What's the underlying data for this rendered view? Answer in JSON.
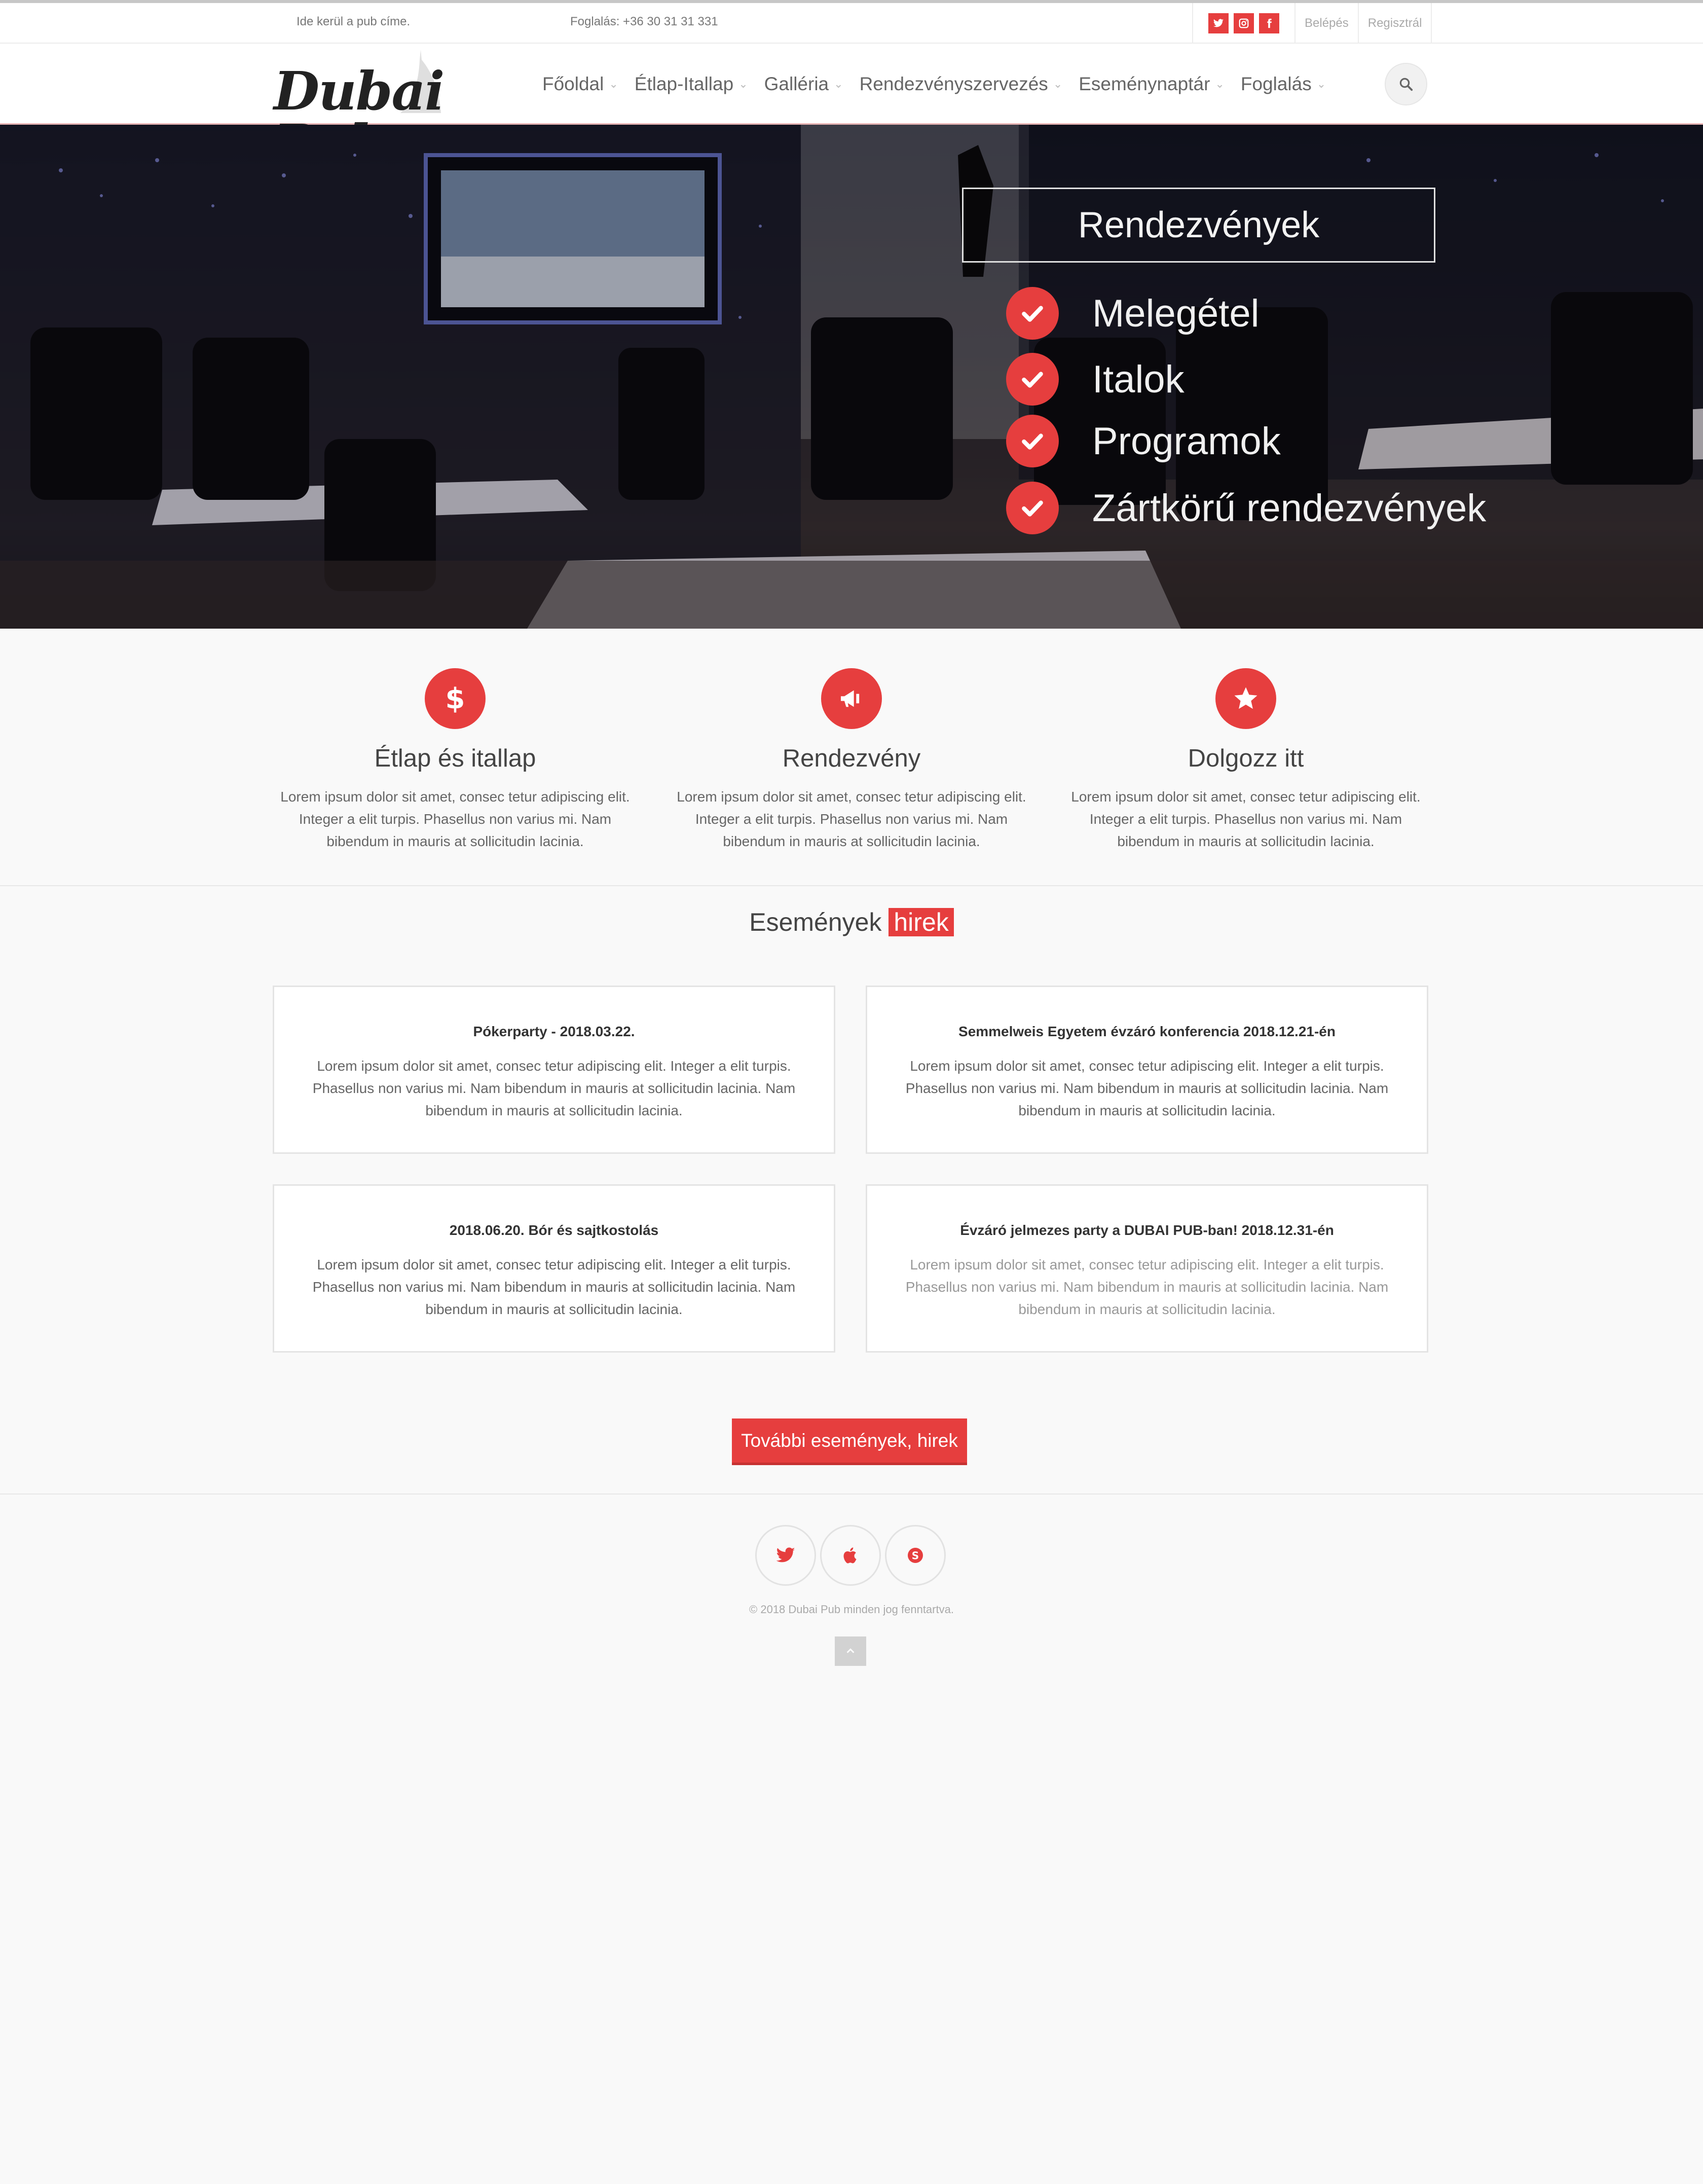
{
  "topbar": {
    "address": "Ide kerül a pub címe.",
    "phone": "Foglalás: +36 30 31 31 331",
    "social_icons": [
      "twitter-icon",
      "instagram-icon",
      "facebook-icon"
    ],
    "login": "Belépés",
    "register": "Regisztrál"
  },
  "header": {
    "logo_text": "Dubai Pub",
    "nav": [
      {
        "label": "Főoldal",
        "has_dropdown": true
      },
      {
        "label": "Étlap-Itallap",
        "has_dropdown": true
      },
      {
        "label": "Galléria",
        "has_dropdown": true
      },
      {
        "label": "Rendezvényszervezés",
        "has_dropdown": true
      },
      {
        "label": "Eseménynaptár",
        "has_dropdown": true
      },
      {
        "label": "Foglalás",
        "has_dropdown": true
      }
    ],
    "search_icon": "search-icon"
  },
  "hero": {
    "title": "Rendezvények",
    "items": [
      "Melegétel",
      "Italok",
      "Programok",
      "Zártkörű rendezvények"
    ]
  },
  "features": [
    {
      "icon": "dollar-icon",
      "title": "Étlap és itallap",
      "text": "Lorem ipsum dolor sit amet, consec tetur adipiscing elit. Integer a elit turpis. Phasellus non varius mi. Nam bibendum in mauris at sollicitudin lacinia."
    },
    {
      "icon": "megaphone-icon",
      "title": "Rendezvény",
      "text": "Lorem ipsum dolor sit amet, consec tetur adipiscing elit. Integer a elit turpis. Phasellus non varius mi. Nam bibendum in mauris at sollicitudin lacinia."
    },
    {
      "icon": "star-icon",
      "title": "Dolgozz itt",
      "text": "Lorem ipsum dolor sit amet, consec tetur adipiscing elit. Integer a elit turpis. Phasellus non varius mi. Nam bibendum in mauris at sollicitudin lacinia."
    }
  ],
  "news": {
    "heading": "Események",
    "heading_highlight": "hirek",
    "cards": [
      {
        "title": "Pókerparty - 2018.03.22.",
        "text": "Lorem ipsum dolor sit amet, consec tetur adipiscing elit. Integer a elit turpis. Phasellus non varius mi. Nam bibendum in mauris at sollicitudin lacinia. Nam bibendum in mauris at sollicitudin lacinia."
      },
      {
        "title": "Semmelweis Egyetem évzáró konferencia 2018.12.21-én",
        "text": "Lorem ipsum dolor sit amet, consec tetur adipiscing elit. Integer a elit turpis. Phasellus non varius mi. Nam bibendum in mauris at sollicitudin lacinia. Nam bibendum in mauris at sollicitudin lacinia."
      },
      {
        "title": "2018.06.20. Bór és sajtkostolás",
        "text": "Lorem ipsum dolor sit amet, consec tetur adipiscing elit. Integer a elit turpis. Phasellus non varius mi. Nam bibendum in mauris at sollicitudin lacinia. Nam bibendum in mauris at sollicitudin lacinia."
      },
      {
        "title": "Évzáró jelmezes party a DUBAI PUB-ban! 2018.12.31-én",
        "text": "Lorem ipsum dolor sit amet, consec tetur adipiscing elit. Integer a elit turpis. Phasellus non varius mi. Nam bibendum in mauris at sollicitudin lacinia. Nam bibendum in mauris at sollicitudin lacinia."
      }
    ],
    "more_button": "További események, hirek"
  },
  "footer": {
    "social_icons": [
      "twitter-icon",
      "apple-icon",
      "skype-icon"
    ],
    "copyright": "© 2018 Dubai Pub minden jog fenntartva."
  },
  "colors": {
    "accent": "#e63e3e",
    "background": "#f9f9f9"
  }
}
